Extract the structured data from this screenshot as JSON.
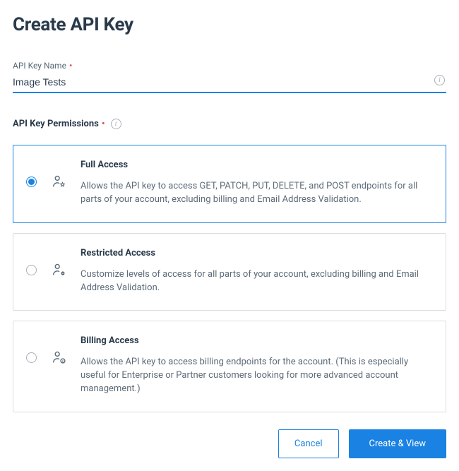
{
  "title": "Create API Key",
  "fields": {
    "name_label": "API Key Name",
    "name_value": "Image Tests",
    "permissions_label": "API Key Permissions"
  },
  "permissions": [
    {
      "id": "full",
      "title": "Full Access",
      "description": "Allows the API key to access GET, PATCH, PUT, DELETE, and POST endpoints for all parts of your account, excluding billing and Email Address Validation.",
      "selected": true,
      "icon": "user-star"
    },
    {
      "id": "restricted",
      "title": "Restricted Access",
      "description": "Customize levels of access for all parts of your account, excluding billing and Email Address Validation.",
      "selected": false,
      "icon": "user-gear"
    },
    {
      "id": "billing",
      "title": "Billing Access",
      "description": "Allows the API key to access billing endpoints for the account. (This is especially useful for Enterprise or Partner customers looking for more advanced account management.)",
      "selected": false,
      "icon": "user-dollar"
    }
  ],
  "actions": {
    "cancel": "Cancel",
    "create": "Create & View"
  },
  "colors": {
    "accent": "#1a82e2",
    "heading": "#293a4a",
    "text": "#5d6b78",
    "required": "#d9534f"
  }
}
